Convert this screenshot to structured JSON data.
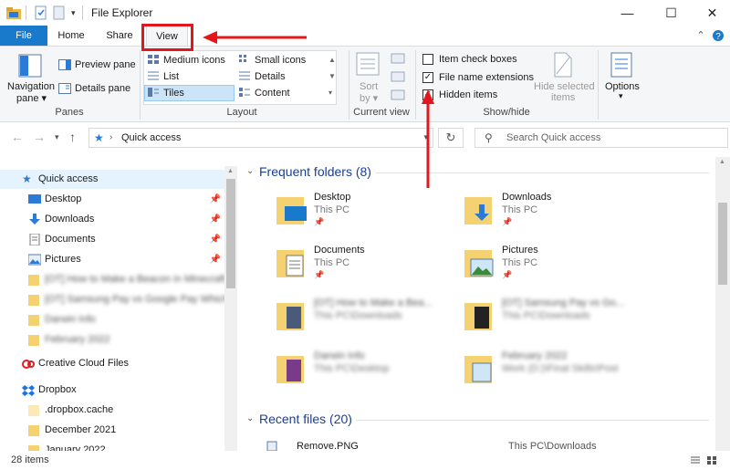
{
  "window": {
    "title": "File Explorer",
    "controls": [
      "—",
      "☐",
      "✕"
    ]
  },
  "menu": {
    "file": "File",
    "home": "Home",
    "share": "Share",
    "view": "View"
  },
  "ribbon": {
    "panes": {
      "navigation_pane": "Navigation",
      "navigation_pane_2": "pane ▾",
      "preview_pane": "Preview pane",
      "details_pane": "Details pane",
      "group_label": "Panes"
    },
    "layout": {
      "items": [
        "Medium icons",
        "Small icons",
        "List",
        "Details",
        "Tiles",
        "Content"
      ],
      "selected": "Tiles",
      "group_label": "Layout"
    },
    "current_view": {
      "sort_by": "Sort",
      "sort_by_2": "by ▾",
      "group_label": "Current view"
    },
    "show_hide": {
      "item_check_boxes": "Item check boxes",
      "file_name_extensions": "File name extensions",
      "hidden_items": "Hidden items",
      "hide_selected": "Hide selected",
      "hide_selected_2": "items",
      "group_label": "Show/hide"
    },
    "options": {
      "label": "Options",
      "caret": "▾"
    }
  },
  "address": {
    "path": "Quick access",
    "search_placeholder": "Search Quick access"
  },
  "nav": {
    "items": [
      {
        "label": "Quick access",
        "pinned": false
      },
      {
        "label": "Desktop",
        "pinned": true
      },
      {
        "label": "Downloads",
        "pinned": true
      },
      {
        "label": "Documents",
        "pinned": true
      },
      {
        "label": "Pictures",
        "pinned": true
      },
      {
        "label": "[OT] How to Make a Beacon in Minecraft",
        "pinned": false
      },
      {
        "label": "[OT] Samsung Pay vs Google Pay Which",
        "pinned": false
      },
      {
        "label": "Darwin Info",
        "pinned": false
      },
      {
        "label": "February 2022",
        "pinned": false
      },
      {
        "label": "Creative Cloud Files",
        "pinned": false
      },
      {
        "label": "Dropbox",
        "pinned": false
      },
      {
        "label": ".dropbox.cache",
        "pinned": false
      },
      {
        "label": "December 2021",
        "pinned": false
      },
      {
        "label": "January 2022",
        "pinned": false
      }
    ]
  },
  "content": {
    "frequent_header": "Frequent folders (8)",
    "recent_header": "Recent files (20)",
    "folders": [
      {
        "name": "Desktop",
        "sub": "This PC"
      },
      {
        "name": "Downloads",
        "sub": "This PC"
      },
      {
        "name": "Documents",
        "sub": "This PC"
      },
      {
        "name": "Pictures",
        "sub": "This PC"
      },
      {
        "name": "[OT] How to Make a Bea...",
        "sub": "This PC\\Downloads"
      },
      {
        "name": "[OT] Samsung Pay vs Go...",
        "sub": "This PC\\Downloads"
      },
      {
        "name": "Darwin Info",
        "sub": "This PC\\Desktop"
      },
      {
        "name": "February 2022",
        "sub": "Work (D:)\\Final Skills\\Post"
      }
    ],
    "recent_files": [
      {
        "name": "Remove.PNG",
        "location": "This PC\\Downloads"
      }
    ]
  },
  "status": {
    "items_count": "28 items"
  },
  "colors": {
    "accent": "#1979ca",
    "highlight_red": "#e3161b",
    "section_header": "#1a3f94"
  }
}
